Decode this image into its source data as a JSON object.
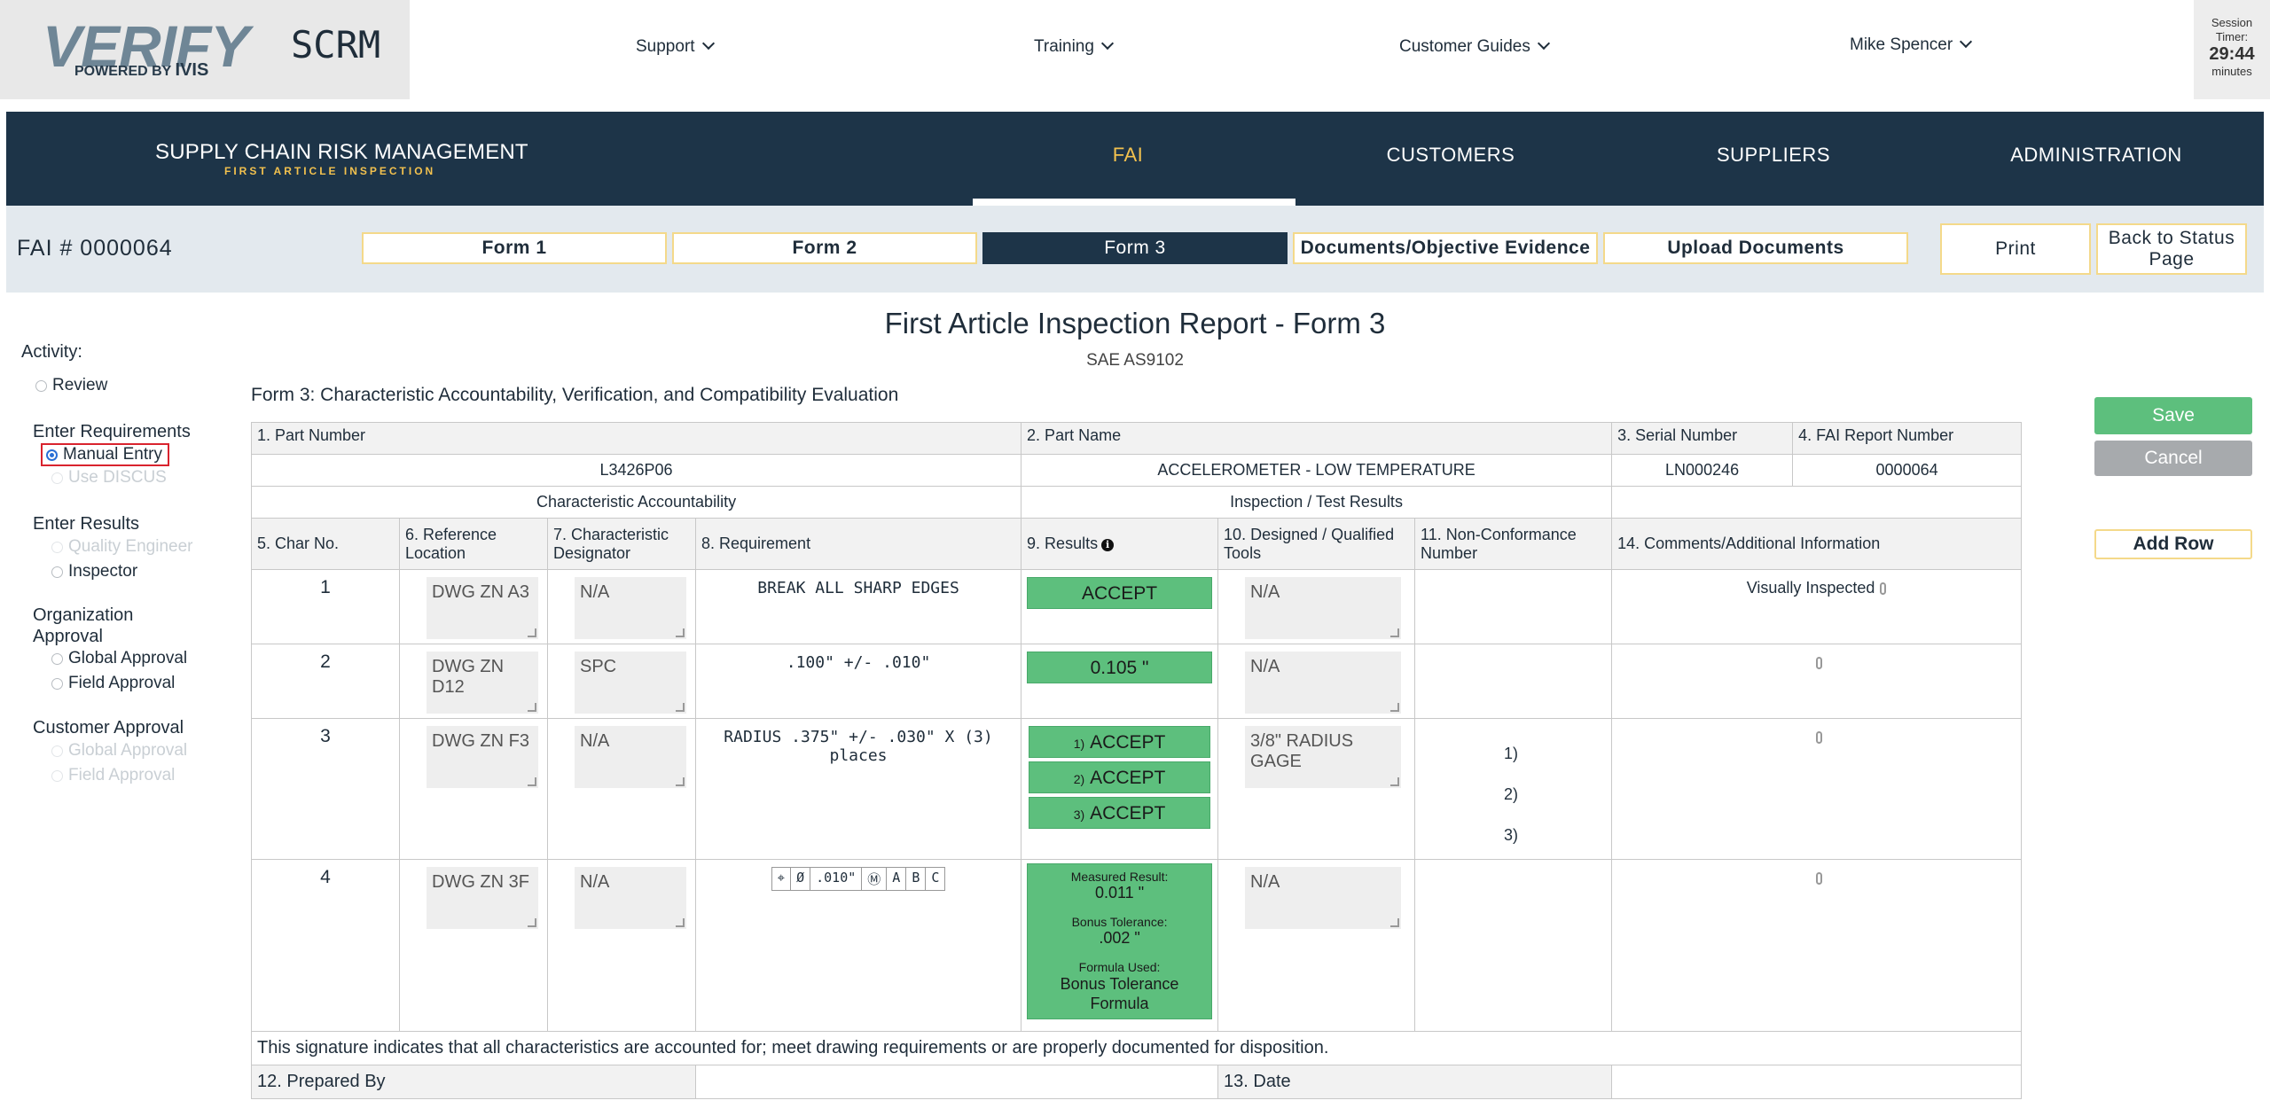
{
  "header": {
    "logo_word": "VERIFY",
    "logo_powered": "POWERED BY",
    "logo_brand": "IVIS",
    "app_name": "SCRM",
    "nav": [
      "Support",
      "Training",
      "Customer Guides"
    ],
    "user": "Mike Spencer",
    "session_label_1": "Session",
    "session_label_2": "Timer:",
    "session_time": "29:44",
    "session_unit": "minutes"
  },
  "mainnav": {
    "brand_title": "SUPPLY CHAIN RISK MANAGEMENT",
    "brand_sub": "FIRST ARTICLE INSPECTION",
    "items": [
      "FAI",
      "CUSTOMERS",
      "SUPPLIERS",
      "ADMINISTRATION"
    ],
    "active": "FAI"
  },
  "tabbar": {
    "fai_number": "FAI # 0000064",
    "tabs": [
      "Form 1",
      "Form 2",
      "Form 3",
      "Documents/Objective Evidence",
      "Upload Documents"
    ],
    "active_tab": "Form 3",
    "print": "Print",
    "back": "Back to Status Page"
  },
  "sidebar": {
    "activity_label": "Activity:",
    "review": "Review",
    "enter_req": "Enter Requirements",
    "manual_entry": "Manual Entry",
    "use_discus": "Use DISCUS",
    "enter_results": "Enter Results",
    "quality_engineer": "Quality Engineer",
    "inspector": "Inspector",
    "org_approval": "Organization Approval",
    "global_approval": "Global Approval",
    "field_approval": "Field Approval",
    "cust_approval": "Customer Approval",
    "cust_global": "Global Approval",
    "cust_field": "Field Approval"
  },
  "report": {
    "title": "First Article Inspection Report - Form 3",
    "standard": "SAE AS9102",
    "caption": "Form 3: Characteristic Accountability, Verification, and Compatibility Evaluation",
    "h_part_number": "1. Part Number",
    "h_part_name": "2. Part Name",
    "h_serial": "3. Serial Number",
    "h_fai_report": "4. FAI Report Number",
    "part_number": "L3426P06",
    "part_name": "ACCELEROMETER - LOW TEMPERATURE",
    "serial": "LN000246",
    "fai_report": "0000064",
    "group_char": "Characteristic Accountability",
    "group_insp": "Inspection / Test Results",
    "col_charno": "5. Char No.",
    "col_refloc": "6. Reference Location",
    "col_desig": "7. Characteristic Designator",
    "col_req": "8. Requirement",
    "col_results": "9. Results",
    "col_tools": "10. Designed / Qualified Tools",
    "col_ncr": "11. Non-Conformance Number",
    "col_comments": "14. Comments/Additional Information",
    "rows": [
      {
        "no": "1",
        "ref": "DWG ZN A3",
        "desig": "N/A",
        "req": "BREAK ALL SHARP EDGES",
        "result": "ACCEPT",
        "tools": "N/A",
        "comment": "Visually Inspected"
      },
      {
        "no": "2",
        "ref": "DWG ZN D12",
        "desig": "SPC",
        "req": ".100\" +/- .010\"",
        "result": "0.105 \"",
        "tools": "N/A",
        "comment": ""
      },
      {
        "no": "3",
        "ref": "DWG ZN F3",
        "desig": "N/A",
        "req": "RADIUS .375\" +/- .030\" X (3) places",
        "results": [
          "ACCEPT",
          "ACCEPT",
          "ACCEPT"
        ],
        "result_nums": [
          "1)",
          "2)",
          "3)"
        ],
        "tools": "3/8\" RADIUS GAGE",
        "ncr": [
          "1)",
          "2)",
          "3)"
        ],
        "comment": ""
      },
      {
        "no": "4",
        "ref": "DWG ZN 3F",
        "desig": "N/A",
        "gdt": [
          "⌖",
          "Ø",
          ".010\"",
          "Ⓜ",
          "A",
          "B",
          "C"
        ],
        "measured_label": "Measured Result:",
        "measured": "0.011 \"",
        "bonus_label": "Bonus Tolerance:",
        "bonus": ".002 \"",
        "formula_label": "Formula Used:",
        "formula": "Bonus Tolerance Formula",
        "tools": "N/A",
        "comment": ""
      }
    ],
    "signature_note": "This signature indicates that all characteristics are accounted for; meet drawing requirements or are properly documented for disposition.",
    "prepared_by": "12. Prepared By",
    "date": "13. Date"
  },
  "actions": {
    "save": "Save",
    "cancel": "Cancel",
    "add_row": "Add Row"
  },
  "colors": {
    "nav_bg": "#1d3448",
    "accent_gold": "#f2c14e",
    "accept_green": "#5dbf7d",
    "tab_border": "#f4d98a"
  }
}
